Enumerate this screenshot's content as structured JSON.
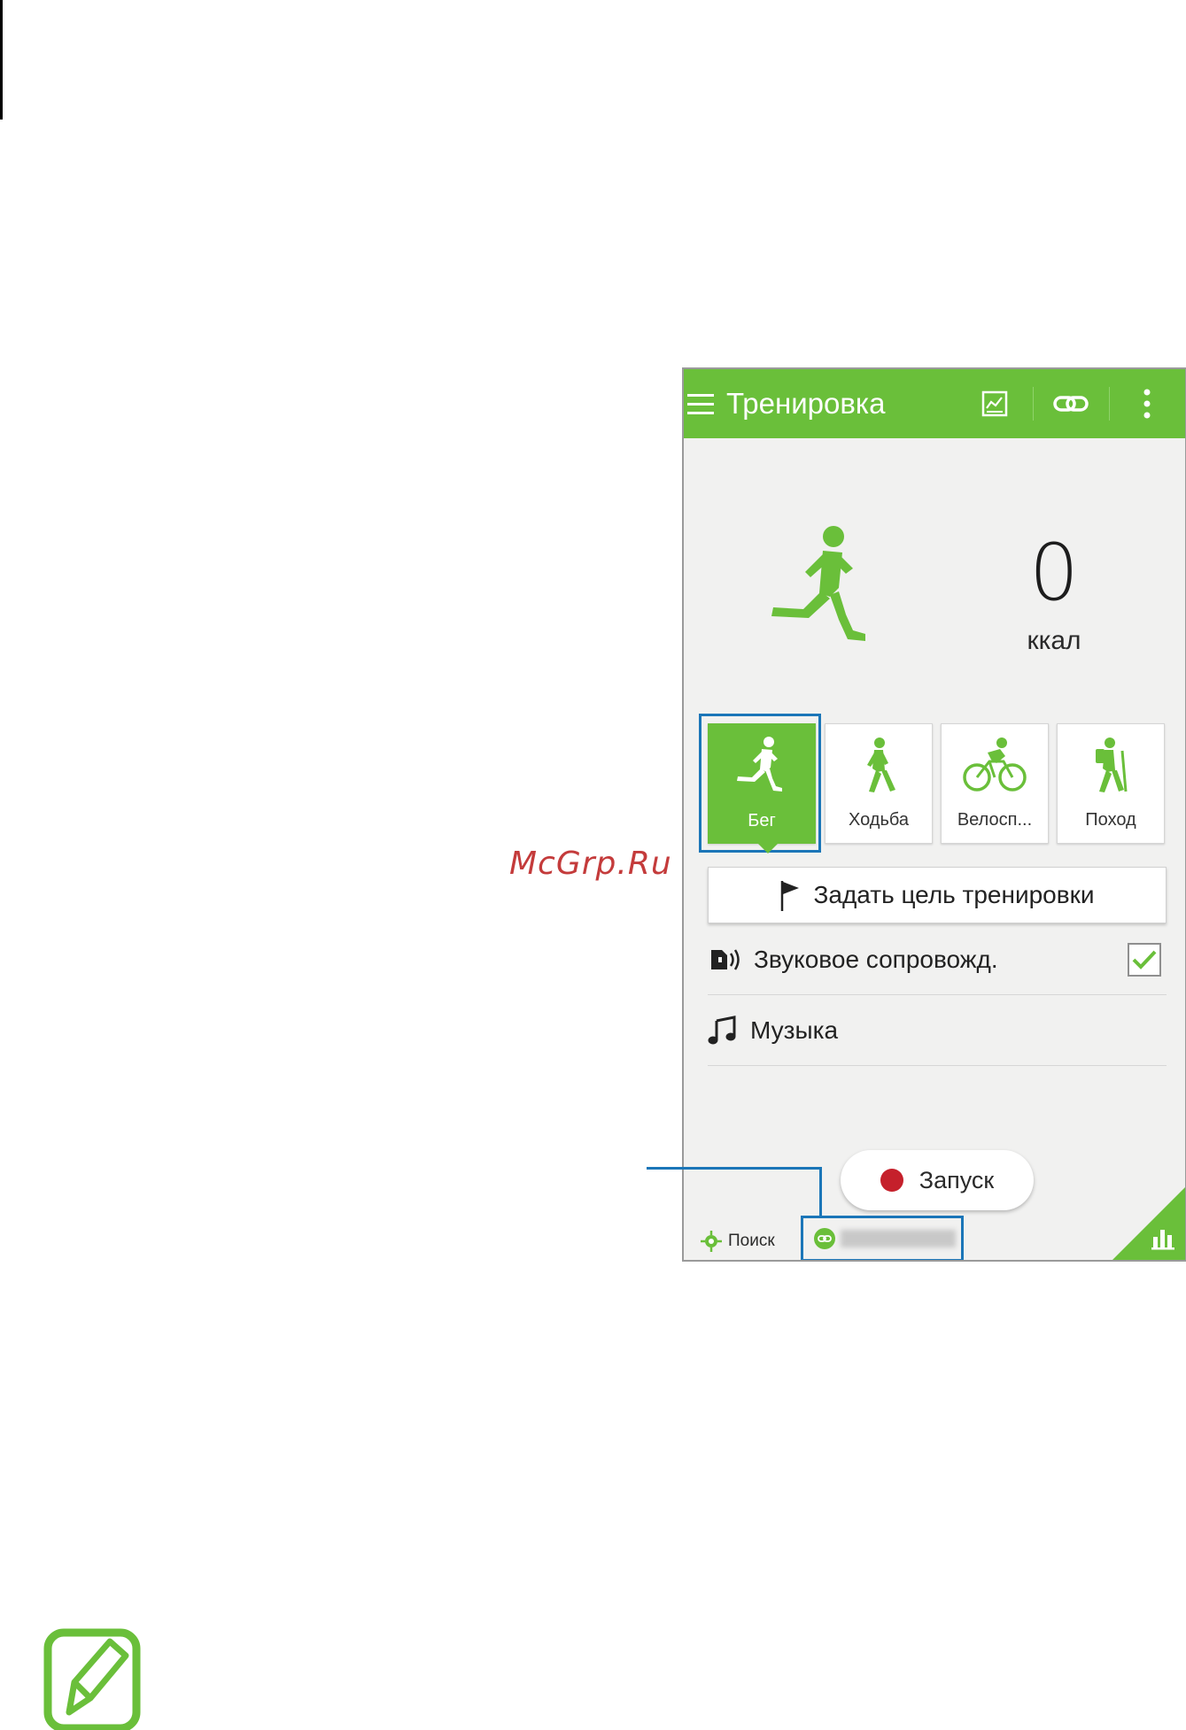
{
  "watermark": "McGrp.Ru",
  "appbar": {
    "title": "Тренировка",
    "icons": [
      "menu-icon",
      "chart-icon",
      "link-icon",
      "more-icon"
    ]
  },
  "hero": {
    "kcal_value": "0",
    "kcal_unit": "ккал"
  },
  "activities": [
    {
      "label": "Бег",
      "icon": "running-icon",
      "selected": true
    },
    {
      "label": "Ходьба",
      "icon": "walking-icon",
      "selected": false
    },
    {
      "label": "Велосп...",
      "icon": "cycling-icon",
      "selected": false
    },
    {
      "label": "Поход",
      "icon": "hiking-icon",
      "selected": false
    }
  ],
  "goal": {
    "label": "Задать цель тренировки"
  },
  "settings": {
    "audio_label": "Звуковое сопровожд.",
    "audio_checked": true,
    "music_label": "Музыка"
  },
  "start": {
    "label": "Запуск"
  },
  "status": {
    "search_label": "Поиск"
  },
  "colors": {
    "accent": "#6abf3a",
    "highlight": "#1b76b8",
    "record": "#c5202b",
    "background": "#f1f1f0"
  }
}
